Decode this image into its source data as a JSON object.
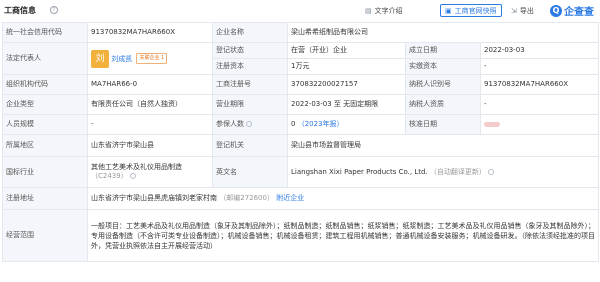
{
  "header": {
    "title": "工商信息",
    "tools": [
      "文字介绍",
      "工商官网快照",
      "导出"
    ],
    "brand": "企查查"
  },
  "rows": {
    "uscc_label": "统一社会信用代码",
    "uscc": "91370832MA7HAR660X",
    "name_label": "企业名称",
    "name": "梁山希希纸制品有限公司",
    "legal_label": "法定代表人",
    "avatar_char": "刘",
    "legal_name": "刘成凯",
    "legal_badge": "关联企业 1",
    "status_label": "登记状态",
    "status": "在营（开业）企业",
    "found_label": "成立日期",
    "found": "2022-03-03",
    "regcap_label": "注册资本",
    "regcap": "1万元",
    "paidcap_label": "实缴资本",
    "paidcap": "-",
    "org_label": "组织机构代码",
    "org": "MA7HAR66-0",
    "regno_label": "工商注册号",
    "regno": "370832200027157",
    "taxno_label": "纳税人识别号",
    "taxno": "91370832MA7HAR660X",
    "type_label": "企业类型",
    "type": "有限责任公司（自然人独资）",
    "term_label": "营业期限",
    "term": "2022-03-03 至 无固定期限",
    "taxq_label": "纳税人资质",
    "taxq": "-",
    "staff_label": "人员规模",
    "staff": "-",
    "insured_label": "参保人数",
    "insured": "0",
    "insured_year": "（2023年报）",
    "approve_label": "核准日期",
    "region_label": "所属地区",
    "region": "山东省济宁市梁山县",
    "authority_label": "登记机关",
    "authority": "梁山县市场监督管理局",
    "industry_label": "国标行业",
    "industry": "其他工艺美术及礼仪用品制造",
    "industry_code": "（C2439）",
    "en_label": "英文名",
    "en": "Liangshan Xixi Paper Products Co., Ltd.",
    "en_note": "（自动翻译更新）",
    "addr_label": "注册地址",
    "addr": "山东省济宁市梁山县黑虎庙镇刘老家村南",
    "addr_post": "（邮编272600）",
    "addr_link": "附近企业",
    "scope_label": "经营范围",
    "scope": "一般项目：工艺美术品及礼仪用品制造（象牙及其制品除外）；纸制品制造；纸制品销售；纸浆销售；纸浆制造；工艺美术品及礼仪用品销售（象牙及其制品除外）；专用设备制造（不含许可类专业设备制造）；机械设备销售；机械设备租赁；建筑工程用机械销售；普通机械设备安装服务；机械设备研发。（除依法须经批准的项目外，凭营业执照依法自主开展经营活动）"
  }
}
